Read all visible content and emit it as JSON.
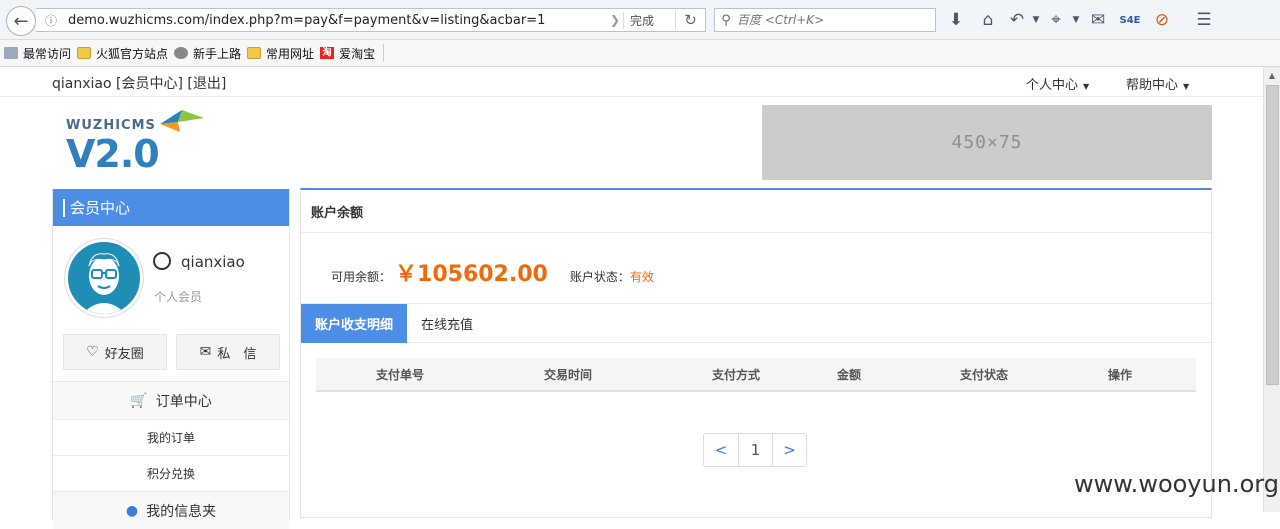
{
  "browser": {
    "url": "demo.wuzhicms.com/index.php?m=pay&f=payment&v=listing&acbar=1",
    "status": "完成",
    "search_placeholder": "百度 <Ctrl+K>"
  },
  "bookmarks": [
    "最常访问",
    "火狐官方站点",
    "新手上路",
    "常用网址",
    "爱淘宝"
  ],
  "topbar": {
    "user_links": "qianxiao [会员中心] [退出]",
    "menu_personal": "个人中心",
    "menu_help": "帮助中心"
  },
  "logo": {
    "small": "WUZHICMS",
    "big": "V2.0"
  },
  "banner": {
    "size_label": "450×75"
  },
  "sidebar": {
    "title": "会员中心",
    "username": "qianxiao",
    "group": "个人会员",
    "btn_friends": "好友圈",
    "btn_message": "私　信",
    "section_orders": "订单中心",
    "link_my_orders": "我的订单",
    "link_points": "积分兑换",
    "section_info": "我的信息夹"
  },
  "main": {
    "title": "账户余额",
    "balance_label": "可用余额：",
    "balance_amount": "￥105602.00",
    "status_label": "账户状态：",
    "status_value": "有效",
    "tabs": [
      "账户收支明细",
      "在线充值"
    ],
    "columns": [
      "支付单号",
      "交易时间",
      "支付方式",
      "金额",
      "支付状态",
      "操作"
    ],
    "pager": {
      "prev": "<",
      "current": "1",
      "next": ">"
    }
  },
  "watermark": "www.wooyun.org",
  "colors": {
    "accent": "#4c8ee6",
    "amount": "#f06a0c"
  }
}
